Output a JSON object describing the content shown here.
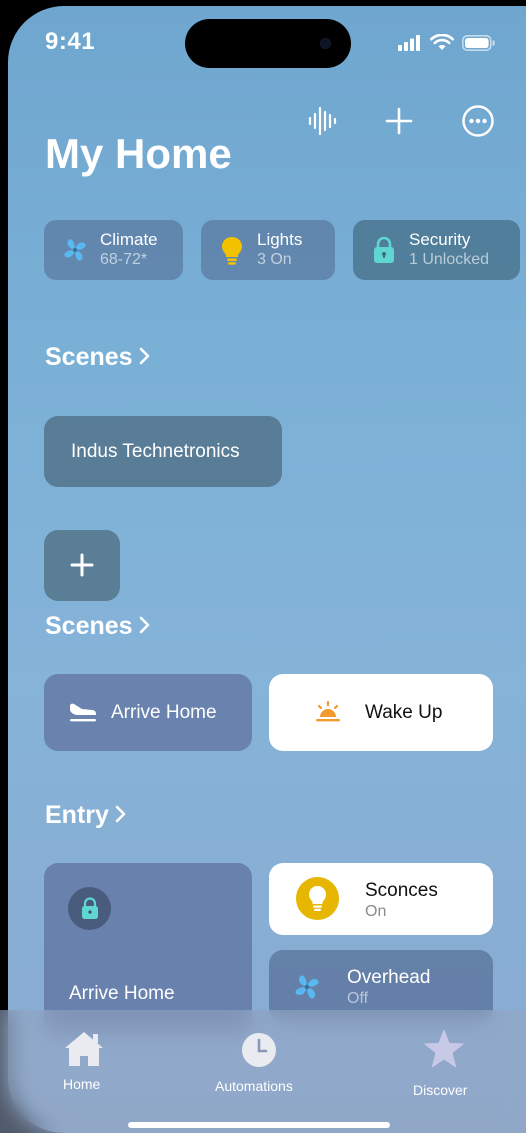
{
  "status": {
    "time": "9:41"
  },
  "header": {
    "title": "My Home"
  },
  "summary": [
    {
      "title": "Climate",
      "subtitle": "68-72*"
    },
    {
      "title": "Lights",
      "subtitle": "3 On"
    },
    {
      "title": "Security",
      "subtitle": "1 Unlocked"
    }
  ],
  "scenes1": {
    "heading": "Scenes",
    "tile": "Indus Technetronics"
  },
  "scenes2": {
    "heading": "Scenes",
    "arrive": "Arrive Home",
    "wake": "Wake Up"
  },
  "entry": {
    "heading": "Entry",
    "lock_tile": "Arrive Home",
    "sconces": {
      "title": "Sconces",
      "status": "On"
    },
    "overhead": {
      "title": "Overhead",
      "status": "Off"
    }
  },
  "tabs": [
    {
      "label": "Home"
    },
    {
      "label": "Automations"
    },
    {
      "label": "Discover"
    }
  ],
  "colors": {
    "accent_yellow": "#e6b600",
    "accent_teal": "#5fd6d0",
    "fan_blue": "#5ab8f0",
    "sun_orange": "#f29a2e"
  }
}
